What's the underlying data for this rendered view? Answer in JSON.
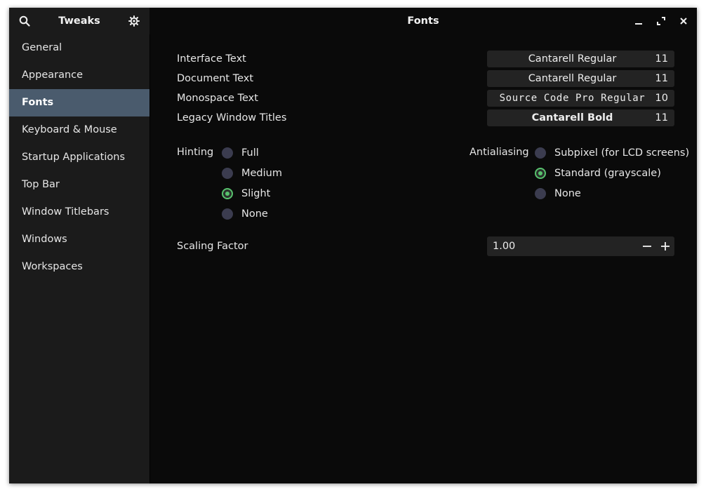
{
  "app": {
    "title": "Tweaks",
    "page_title": "Fonts"
  },
  "header": {
    "icons": [
      "search-icon",
      "gear-icon",
      "minimize-icon",
      "maximize-icon",
      "close-icon"
    ]
  },
  "sidebar": {
    "items": [
      {
        "label": "General"
      },
      {
        "label": "Appearance"
      },
      {
        "label": "Fonts",
        "selected": true
      },
      {
        "label": "Keyboard & Mouse"
      },
      {
        "label": "Startup Applications"
      },
      {
        "label": "Top Bar"
      },
      {
        "label": "Window Titlebars"
      },
      {
        "label": "Windows"
      },
      {
        "label": "Workspaces"
      }
    ]
  },
  "fonts": {
    "rows": [
      {
        "label": "Interface Text",
        "font": "Cantarell Regular",
        "size": "11"
      },
      {
        "label": "Document Text",
        "font": "Cantarell Regular",
        "size": "11"
      },
      {
        "label": "Monospace Text",
        "font": "Source Code Pro Regular",
        "size": "10"
      },
      {
        "label": "Legacy Window Titles",
        "font": "Cantarell Bold",
        "size": "11"
      }
    ]
  },
  "hinting": {
    "label": "Hinting",
    "options": [
      {
        "label": "Full",
        "checked": false
      },
      {
        "label": "Medium",
        "checked": false
      },
      {
        "label": "Slight",
        "checked": true
      },
      {
        "label": "None",
        "checked": false
      }
    ]
  },
  "antialiasing": {
    "label": "Antialiasing",
    "options": [
      {
        "label": "Subpixel (for LCD screens)",
        "checked": false
      },
      {
        "label": "Standard (grayscale)",
        "checked": true
      },
      {
        "label": "None",
        "checked": false
      }
    ]
  },
  "scaling": {
    "label": "Scaling Factor",
    "value": "1.00"
  },
  "colors": {
    "window_bg": "#0a0a0a",
    "sidebar_bg": "#1b1b1b",
    "selected_bg": "#4a5b6d",
    "accent_green": "#57c26d",
    "radio_unchecked": "#3b3c4f"
  }
}
